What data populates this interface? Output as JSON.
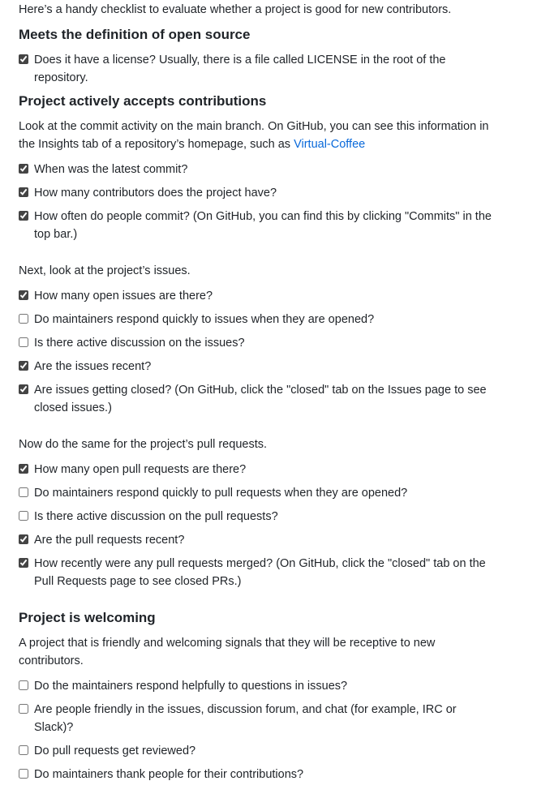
{
  "intro": "Here’s a handy checklist to evaluate whether a project is good for new contributors.",
  "sections": {
    "open_source": {
      "heading": "Meets the definition of open source",
      "items": [
        {
          "label": "Does it have a license? Usually, there is a file called LICENSE in the root of the repository.",
          "checked": true
        }
      ]
    },
    "contributions": {
      "heading": "Project actively accepts contributions",
      "text_prefix": "Look at the commit activity on the main branch. On GitHub, you can see this information in the Insights tab of a repository’s homepage, such as ",
      "link_text": "Virtual-Coffee",
      "commit_items": [
        {
          "label": "When was the latest commit?",
          "checked": true
        },
        {
          "label": "How many contributors does the project have?",
          "checked": true
        },
        {
          "label": "How often do people commit? (On GitHub, you can find this by clicking \"Commits\" in the top bar.)",
          "checked": true
        }
      ],
      "issues_intro": "Next, look at the project’s issues.",
      "issue_items": [
        {
          "label": "How many open issues are there?",
          "checked": true
        },
        {
          "label": "Do maintainers respond quickly to issues when they are opened?",
          "checked": false
        },
        {
          "label": "Is there active discussion on the issues?",
          "checked": false
        },
        {
          "label": "Are the issues recent?",
          "checked": true
        },
        {
          "label": "Are issues getting closed? (On GitHub, click the \"closed\" tab on the Issues page to see closed issues.)",
          "checked": true
        }
      ],
      "prs_intro": "Now do the same for the project’s pull requests.",
      "pr_items": [
        {
          "label": "How many open pull requests are there?",
          "checked": true
        },
        {
          "label": "Do maintainers respond quickly to pull requests when they are opened?",
          "checked": false
        },
        {
          "label": "Is there active discussion on the pull requests?",
          "checked": false
        },
        {
          "label": "Are the pull requests recent?",
          "checked": true
        },
        {
          "label": "How recently were any pull requests merged? (On GitHub, click the \"closed\" tab on the Pull Requests page to see closed PRs.)",
          "checked": true
        }
      ]
    },
    "welcoming": {
      "heading": "Project is welcoming",
      "text": "A project that is friendly and welcoming signals that they will be receptive to new contributors.",
      "items": [
        {
          "label": "Do the maintainers respond helpfully to questions in issues?",
          "checked": false
        },
        {
          "label": "Are people friendly in the issues, discussion forum, and chat (for example, IRC or Slack)?",
          "checked": false
        },
        {
          "label": "Do pull requests get reviewed?",
          "checked": false
        },
        {
          "label": "Do maintainers thank people for their contributions?",
          "checked": false
        }
      ]
    }
  }
}
